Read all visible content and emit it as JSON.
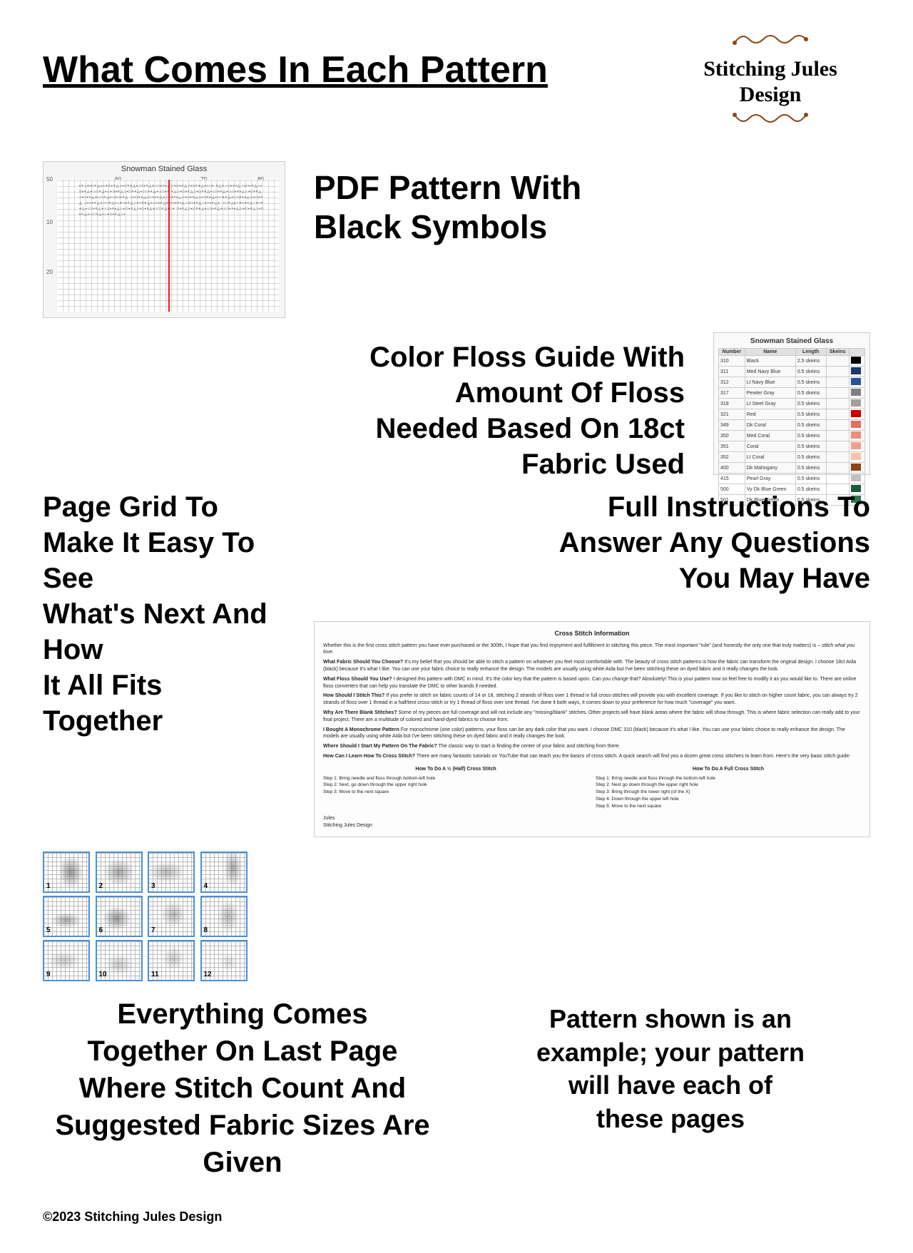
{
  "header": {
    "title": "What Comes In Each Pattern",
    "logo_line1": "Stitching Jules Design"
  },
  "section_pdf": {
    "pattern_preview_title": "Snowman Stained Glass",
    "label_line1": "PDF Pattern With",
    "label_line2": "Black Symbols"
  },
  "section_floss": {
    "guide_title": "Snowman Stained Glass",
    "label_line1": "Color Floss Guide With",
    "label_line2": "Amount Of Floss",
    "label_line3": "Needed Based On 18ct",
    "label_line4": "Fabric Used",
    "table_headers": [
      "Number",
      "Name",
      "Length",
      "Skeins"
    ],
    "rows": [
      {
        "number": "310",
        "name": "Black",
        "length": "2.5 skeins",
        "color": "#000000"
      },
      {
        "number": "311",
        "name": "Med Navy Blue",
        "length": "0.5 skeins",
        "color": "#1a3a6b"
      },
      {
        "number": "312",
        "name": "Lt Navy Blue",
        "length": "0.5 skeins",
        "color": "#2a5298"
      },
      {
        "number": "317",
        "name": "Pewter Gray",
        "length": "0.5 skeins",
        "color": "#808080"
      },
      {
        "number": "318",
        "name": "Lt Steel Gray",
        "length": "0.5 skeins",
        "color": "#a0a0a0"
      },
      {
        "number": "321",
        "name": "Red",
        "length": "0.5 skeins",
        "color": "#cc0000"
      },
      {
        "number": "349",
        "name": "Dk Coral",
        "length": "0.5 skeins",
        "color": "#e07060"
      },
      {
        "number": "350",
        "name": "Med Coral",
        "length": "0.5 skeins",
        "color": "#e8907a"
      },
      {
        "number": "351",
        "name": "Coral",
        "length": "0.5 skeins",
        "color": "#f0a090"
      },
      {
        "number": "352",
        "name": "Lt Coral",
        "length": "0.5 skeins",
        "color": "#f8c0b0"
      },
      {
        "number": "400",
        "name": "Dk Mahogany",
        "length": "0.5 skeins",
        "color": "#8B4513"
      },
      {
        "number": "415",
        "name": "Pearl Gray",
        "length": "0.5 skeins",
        "color": "#c0c0c0"
      },
      {
        "number": "500",
        "name": "Vy Dk Blue Green",
        "length": "0.5 skeins",
        "color": "#1a5c3a"
      },
      {
        "number": "501",
        "name": "Dk Blue Green",
        "length": "0.5 skeins",
        "color": "#2a7a50"
      }
    ]
  },
  "section_grid": {
    "label_line1": "Page Grid To",
    "label_line2": "Make It Easy To See",
    "label_line3": "What's Next And How",
    "label_line4": "It All Fits Together",
    "page_numbers": [
      "1",
      "2",
      "3",
      "4",
      "5",
      "6",
      "7",
      "8",
      "9",
      "10",
      "11",
      "12"
    ]
  },
  "section_instructions": {
    "label_line1": "Full Instructions To",
    "label_line2": "Answer Any Questions",
    "label_line3": "You May Have",
    "doc_title": "Cross Stitch Information",
    "paragraphs": [
      {
        "title": "",
        "text": "Whether this is the first cross stitch pattern you have ever purchased or the 300th, I hope that you find enjoyment and fulfillment in stitching this piece. The most important \"rule\" (and honestly the only one that truly matters) is – stitch what you love."
      },
      {
        "title": "What Fabric Should You Choose?",
        "text": "It's my belief that you should be able to stitch a pattern on whatever you feel most comfortable with. The beauty of cross stitch patterns is how the fabric can transform the original design. I choose 18ct Aida (black) because it's what I like. You can use your fabric choice to really enhance the design. The models are usually using white Aida but I've been stitching these on dyed fabric and it really changes the look."
      },
      {
        "title": "What Floss Should You Use?",
        "text": "I designed this pattern with DMC in mind. It's the color key that the pattern is based upon. Can you change that? Absolutely! This is your pattern now so feel free to modify it as you would like to. There are online floss converters that can help you translate the DMC to other brands if needed."
      },
      {
        "title": "How Should I Stitch This?",
        "text": "If you prefer to stitch on fabric counts of 14 or 18, stitching 2 strands of floss over 1 thread in full cross-stitches will provide you with excellent coverage. If you like to stitch on higher count fabric, you can always try 2 strands of floss over 1 thread in a half/tent cross-stitch or try 1 thread of floss over one thread. I've done it both ways, it comes down to your preference for how much \"coverage\" you want."
      },
      {
        "title": "Why Are There Blank Stitches?",
        "text": "Some of my pieces are full coverage and will not include any \"missing/blank\" stitches. Other projects will have blank areas where the fabric will show through. This is where fabric selection can really add to your final project. There are a multitude of colored and hand-dyed fabrics to choose from."
      },
      {
        "title": "I Bought A Monochrome Pattern",
        "text": "For monochrome (one color) patterns, your floss can be any dark color that you want. I choose DMC 310 (black) because it's what I like. You can use your fabric choice to really enhance the design. The models are usually using white Aida but I've been stitching these on dyed fabric and it really changes the look."
      },
      {
        "title": "Where Should I Start My Pattern On The Fabric?",
        "text": "The classic way to start is finding the center of your fabric and stitching from there."
      },
      {
        "title": "How Can I Learn How To Cross Stitch?",
        "text": "There are many fantastic tutorials on YouTube that can teach you the basics of cross stitch. A quick search will find you a dozen great cross stitchers to learn from. Here's the very basic stitch guide:"
      }
    ],
    "how_to_half_title": "How To Do A ½ (Half) Cross Stitch",
    "how_to_half_steps": [
      "Step 1: Bring needle and floss through bottom-left hole",
      "Step 2: Next, go down through the upper right hole",
      "Step 3: Move to the next square"
    ],
    "how_to_full_title": "How To Do A Full Cross Stitch",
    "how_to_full_steps": [
      "Step 1: Bring needle and floss through the bottom-left hole",
      "Step 2: Next go down through the upper right hole",
      "Step 3: Bring through the lower right (of the X)",
      "Step 4: Down through the upper left hole",
      "Step 5: Move to the next square"
    ],
    "sign_off": "Jules\nStitching Jules Design"
  },
  "section_bottom": {
    "left_line1": "Everything Comes",
    "left_line2": "Together On Last Page",
    "left_line3": "Where Stitch Count And",
    "left_line4": "Suggested Fabric Sizes Are",
    "left_line5": "Given",
    "right_line1": "Pattern shown is an",
    "right_line2": "example; your pattern",
    "right_line3": "will have each of",
    "right_line4": "these pages"
  },
  "footer": {
    "copyright": "©2023 Stitching Jules Design"
  }
}
